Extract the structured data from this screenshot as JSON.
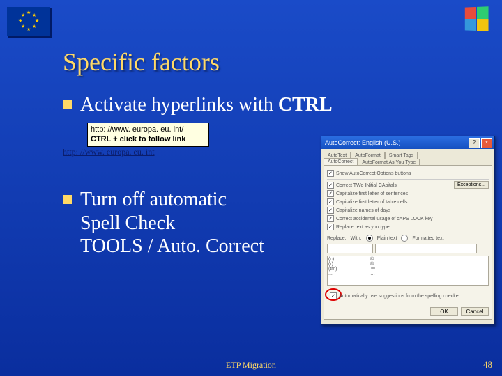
{
  "title": "Specific factors",
  "bullets": {
    "b1": "Activate hyperlinks with CTRL",
    "b2": "Turn off automatic Spell Check TOOLS / Auto. Correct"
  },
  "tooltip": {
    "line1": "http: //www. europa. eu. int/",
    "line2a": "CTRL + click to follow link"
  },
  "link": "http: //www. europa. eu. int",
  "dialog": {
    "title": "AutoCorrect: English (U.S.)",
    "close": "×",
    "help": "?",
    "tabs": {
      "t1": "AutoText",
      "t2": "AutoFormat",
      "t3": "Smart Tags",
      "t4": "AutoCorrect",
      "t5": "AutoFormat As You Type"
    },
    "topcheck": "Show AutoCorrect Options buttons",
    "opts": {
      "o1": "Correct TWo INitial CApitals",
      "o2": "Capitalize first letter of sentences",
      "o3": "Capitalize first letter of table cells",
      "o4": "Capitalize names of days",
      "o5": "Correct accidental usage of cAPS LOCK key",
      "o6": "Replace text as you type"
    },
    "exceptions": "Exceptions...",
    "replace_label": "Replace:",
    "with_label": "With:",
    "radio_plain": "Plain text",
    "radio_fmt": "Formatted text",
    "list": {
      "r1a": "(c)",
      "r1b": "©",
      "r2a": "(r)",
      "r2b": "®",
      "r3a": "(tm)",
      "r3b": "™",
      "r4a": "...",
      "r4b": "…"
    },
    "bottom_chk": "Automatically use suggestions from the spelling checker",
    "ok": "OK",
    "cancel": "Cancel"
  },
  "footer": "ETP Migration",
  "page": "48"
}
